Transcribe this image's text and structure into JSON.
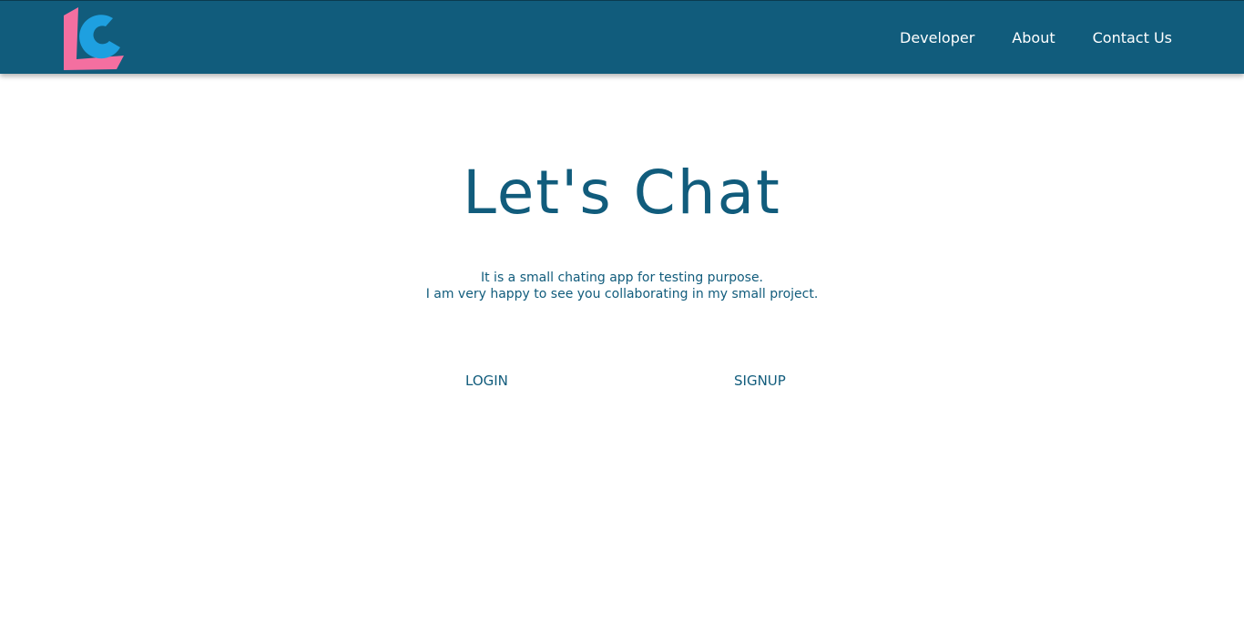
{
  "header": {
    "logo_text": "LC",
    "nav": {
      "developer": "Developer",
      "about": "About",
      "contact": "Contact Us"
    }
  },
  "hero": {
    "title": "Let's Chat",
    "line1": "It is a small chating app for testing purpose.",
    "line2": "I am very happy to see you collaborating in my small project."
  },
  "actions": {
    "login": "LOGIN",
    "signup": "SIGNUP"
  },
  "colors": {
    "header_bg": "#115c7c",
    "text_primary": "#115c7c",
    "logo_pink": "#f46fa0",
    "logo_blue": "#1ea0e0"
  }
}
